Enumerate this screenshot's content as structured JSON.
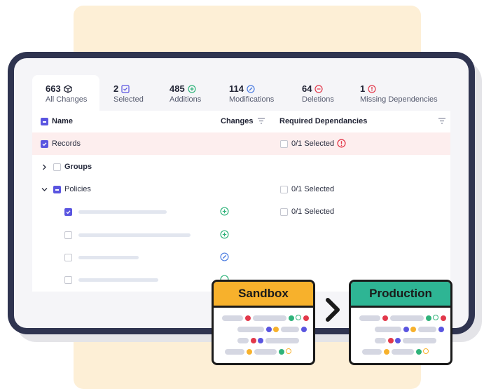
{
  "tabs": [
    {
      "count": "663",
      "label": "All Changes",
      "icon": "cube-icon"
    },
    {
      "count": "2",
      "label": "Selected",
      "icon": "checkbox-icon"
    },
    {
      "count": "485",
      "label": "Additions",
      "icon": "plus-circle-icon"
    },
    {
      "count": "114",
      "label": "Modifications",
      "icon": "edit-circle-icon"
    },
    {
      "count": "64",
      "label": "Deletions",
      "icon": "minus-circle-icon"
    },
    {
      "count": "1",
      "label": "Missing Dependencies",
      "icon": "alert-circle-icon"
    }
  ],
  "table": {
    "headers": {
      "name": "Name",
      "changes": "Changes",
      "required": "Required Dependancies"
    },
    "rows": [
      {
        "name": "Records",
        "required": "0/1 Selected"
      },
      {
        "name": "Groups"
      },
      {
        "name": "Policies",
        "required": "0/1 Selected"
      },
      {
        "required": "0/1 Selected"
      }
    ]
  },
  "environments": {
    "source": "Sandbox",
    "target": "Production"
  },
  "colors": {
    "accent": "#5a55e0",
    "addition": "#2fb37a",
    "modification": "#4a7be0",
    "deletion": "#e2384a",
    "sandbox": "#f7b12c",
    "production": "#2eb594",
    "frame": "#2f3450",
    "cream": "#fdefd6"
  }
}
